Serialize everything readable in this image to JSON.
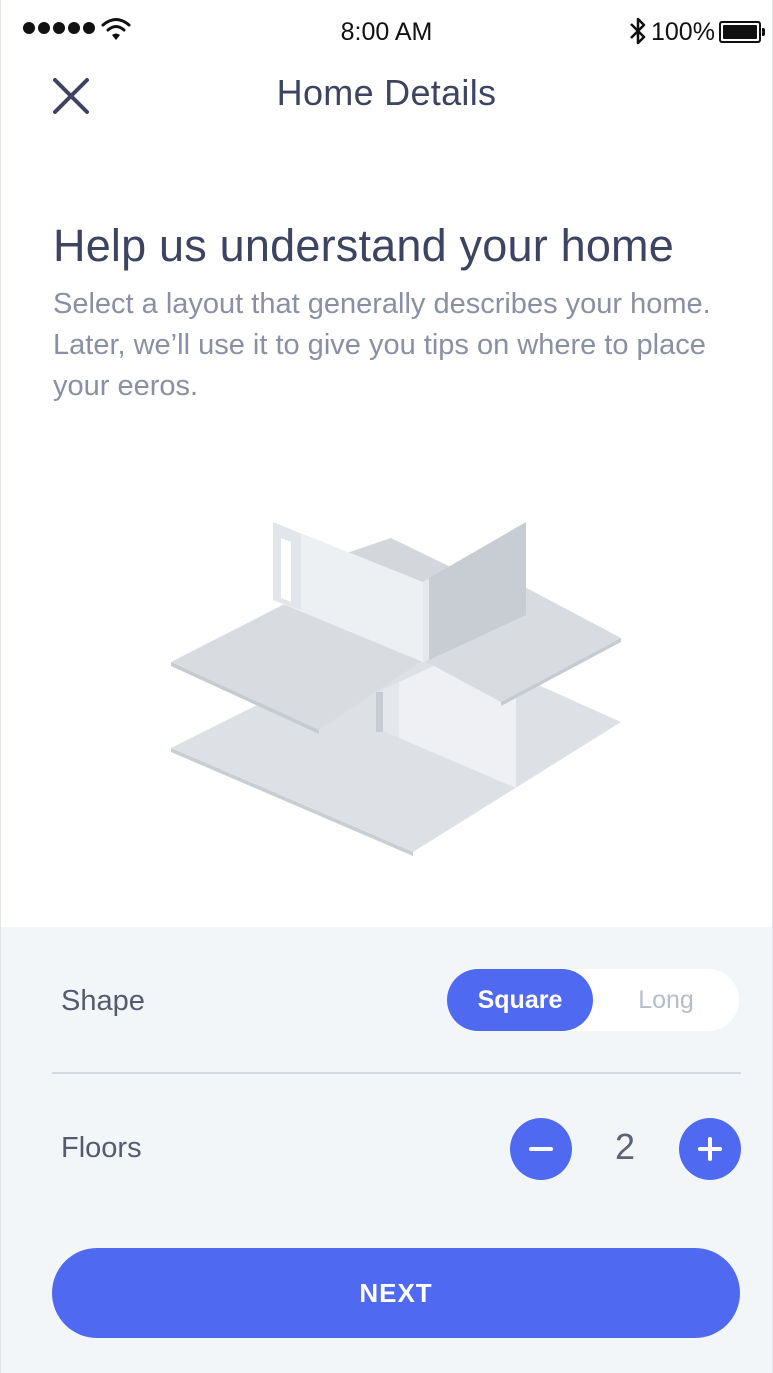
{
  "status_bar": {
    "time": "8:00 AM",
    "battery_percent": "100%",
    "icons": [
      "signal-dots-icon",
      "wifi-icon",
      "bluetooth-icon",
      "battery-icon"
    ]
  },
  "nav": {
    "title": "Home Details",
    "close_icon": "close-icon"
  },
  "intro": {
    "headline": "Help us understand your home",
    "description": "Select a layout that generally describes your home. Later, we’ll use it to give you tips on where to place your eeros."
  },
  "shape": {
    "label": "Shape",
    "options": [
      "Square",
      "Long"
    ],
    "selected": "Square"
  },
  "floors": {
    "label": "Floors",
    "count": "2",
    "decrement_icon": "minus-icon",
    "increment_icon": "plus-icon"
  },
  "next_button": {
    "label": "NEXT"
  },
  "colors": {
    "accent": "#4f6af0",
    "title_text": "#3d4461",
    "body_text": "#8a90a3",
    "panel_bg": "#f3f6f9"
  }
}
